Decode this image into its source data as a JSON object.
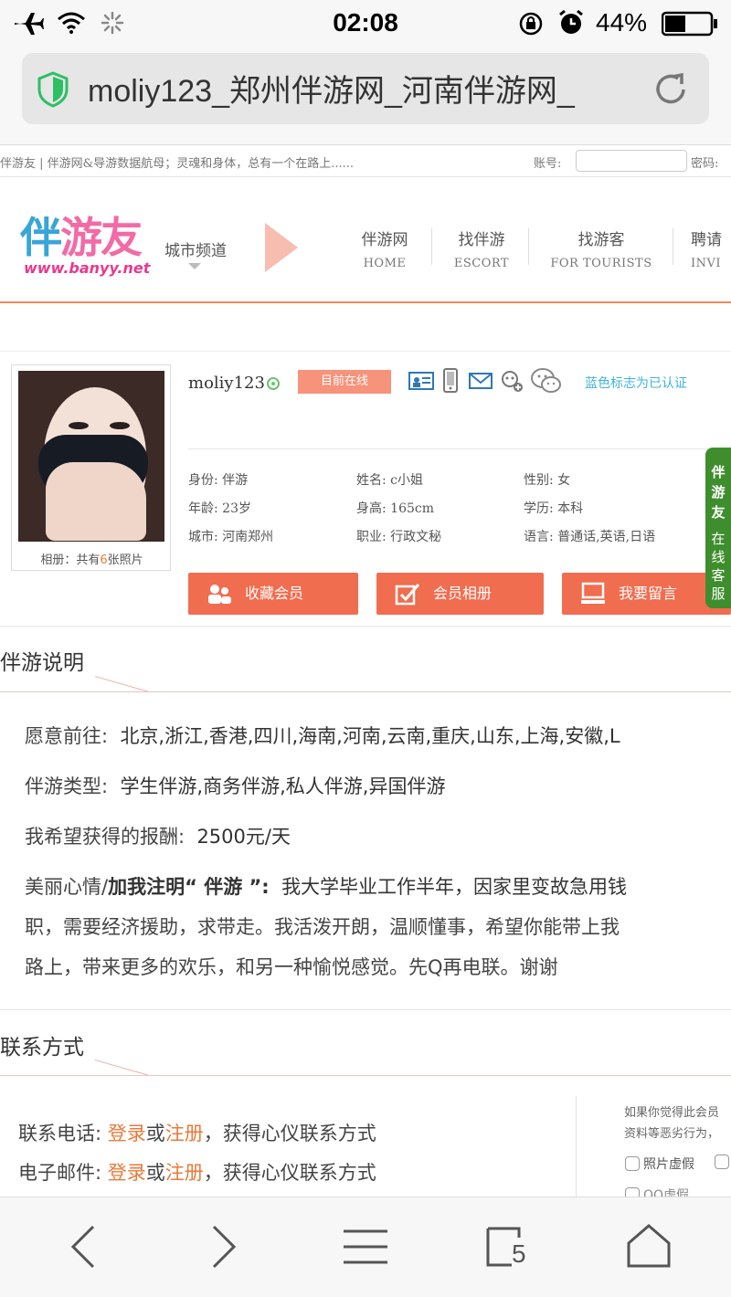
{
  "status_bar": {
    "time": "02:08",
    "battery_pct": "44%"
  },
  "browser": {
    "url_title": "moliy123_郑州伴游网_河南伴游网_",
    "tab_count": "5"
  },
  "site": {
    "tagline": "伴游友 | 伴游网&导游数据航母；灵魂和身体，总有一个在路上......",
    "account_label": "账号:",
    "password_label": "密码:",
    "logo_text_a": "伴",
    "logo_text_b": "游友",
    "logo_url": "www.banyy.net",
    "city_channel": "城市频道",
    "nav": [
      {
        "cn": "伴游网",
        "en": "HOME"
      },
      {
        "cn": "找伴游",
        "en": "ESCORT"
      },
      {
        "cn": "找游客",
        "en": "FOR TOURISTS"
      },
      {
        "cn": "聘请",
        "en": "INVI"
      }
    ]
  },
  "profile": {
    "username": "moliy123",
    "online_badge": "目前在线",
    "verify_note": "蓝色标志为已认证",
    "album_prefix": "相册：共有",
    "album_count": "6",
    "album_suffix": "张照片",
    "fields": [
      {
        "label": "身份:",
        "value": "伴游"
      },
      {
        "label": "姓名:",
        "value": "c小姐"
      },
      {
        "label": "性别:",
        "value": "女"
      },
      {
        "label": "年龄:",
        "value": "23岁"
      },
      {
        "label": "身高:",
        "value": "165cm"
      },
      {
        "label": "学历:",
        "value": "本科"
      },
      {
        "label": "城市:",
        "value": "河南郑州"
      },
      {
        "label": "职业:",
        "value": "行政文秘"
      },
      {
        "label": "语言:",
        "value": "普通话,英语,日语"
      }
    ],
    "buttons": {
      "favorite": "收藏会员",
      "album": "会员相册",
      "message": "我要留言"
    }
  },
  "side_tab": {
    "brand": "伴游友",
    "service": "在线客服"
  },
  "escort_section": {
    "title": "伴游说明",
    "destinations_label": "愿意前往:",
    "destinations": "北京,浙江,香港,四川,海南,河南,云南,重庆,山东,上海,安徽,L",
    "types_label": "伴游类型:",
    "types": "学生伴游,商务伴游,私人伴游,异国伴游",
    "reward_label": "我希望获得的报酬:",
    "reward": "2500元/天",
    "mood_label_a": "美丽心情/",
    "mood_label_b": "加我注明“ 伴游 ”:",
    "mood_line1": "我大学毕业工作半年，因家里变故急用钱",
    "mood_line2": "职，需要经济援助，求带走。我活泼开朗，温顺懂事，希望你能带上我",
    "mood_line3": "路上，带来更多的欢乐，和另一种愉悦感觉。先Q再电联。谢谢"
  },
  "contact_section": {
    "title": "联系方式",
    "phone_label": "联系电话:",
    "email_label": "电子邮件:",
    "login": "登录",
    "or": "或",
    "register": "注册",
    "suffix": "，获得心仪联系方式",
    "report_line1": "如果你觉得此会员",
    "report_line2": "资料等恶劣行为，",
    "report_opt1": "照片虚假",
    "report_opt2": "QQ虚假"
  },
  "colors": {
    "accent": "#f06d50",
    "link": "#e87a3b",
    "verify": "#41b4d8",
    "side_tab": "#3f8e2e"
  }
}
